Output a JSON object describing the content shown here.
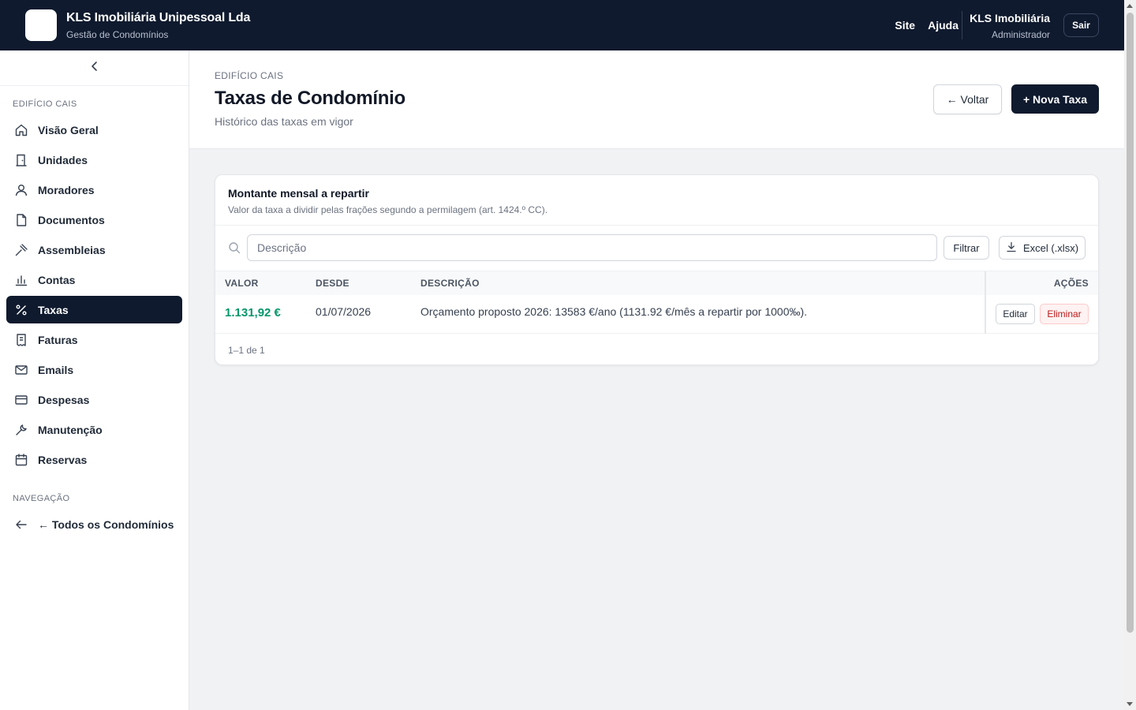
{
  "header": {
    "company_name": "KLS Imobiliária Unipessoal Lda",
    "app_subtitle": "Gestão de Condomínios",
    "links": [
      "Site",
      "Ajuda"
    ],
    "user_name": "KLS Imobiliária",
    "user_role": "Administrador",
    "logout_label": "Sair"
  },
  "sidebar": {
    "section_building": "EDIFÍCIO CAIS",
    "items": [
      {
        "label": "Visão Geral",
        "icon": "home-icon"
      },
      {
        "label": "Unidades",
        "icon": "door-icon"
      },
      {
        "label": "Moradores",
        "icon": "user-icon"
      },
      {
        "label": "Documentos",
        "icon": "file-icon"
      },
      {
        "label": "Assembleias",
        "icon": "gavel-icon"
      },
      {
        "label": "Contas",
        "icon": "bar-chart-icon"
      },
      {
        "label": "Taxas",
        "icon": "percent-icon",
        "active": true
      },
      {
        "label": "Faturas",
        "icon": "receipt-icon"
      },
      {
        "label": "Emails",
        "icon": "mail-icon"
      },
      {
        "label": "Despesas",
        "icon": "credit-card-icon"
      },
      {
        "label": "Manutenção",
        "icon": "wrench-icon"
      },
      {
        "label": "Reservas",
        "icon": "calendar-icon"
      }
    ],
    "section_nav": "NAVEGAÇÃO",
    "all_condos_label": "← Todos os Condomínios"
  },
  "page": {
    "breadcrumb": "EDIFÍCIO CAIS",
    "title": "Taxas de Condomínio",
    "subtitle": "Histórico das taxas em vigor",
    "back_label": "← Voltar",
    "new_label": "+ Nova Taxa"
  },
  "card": {
    "title": "Montante mensal a repartir",
    "subtitle": "Valor da taxa a dividir pelas frações segundo a permilagem (art. 1424.º CC).",
    "search_placeholder": "Descrição",
    "filter_label": "Filtrar",
    "excel_label": "Excel (.xlsx)",
    "columns": [
      "VALOR",
      "DESDE",
      "DESCRIÇÃO",
      "AÇÕES"
    ],
    "rows": [
      {
        "valor": "1.131,92 €",
        "desde": "01/07/2026",
        "descricao": "Orçamento proposto 2026: 13583 €/ano (1131.92 €/mês a repartir por 1000‰).",
        "edit_label": "Editar",
        "delete_label": "Eliminar"
      }
    ],
    "pagination": "1–1 de 1"
  },
  "colors": {
    "navy": "#0f1a2e",
    "value_green": "#059669",
    "danger_red": "#b91c1c"
  }
}
